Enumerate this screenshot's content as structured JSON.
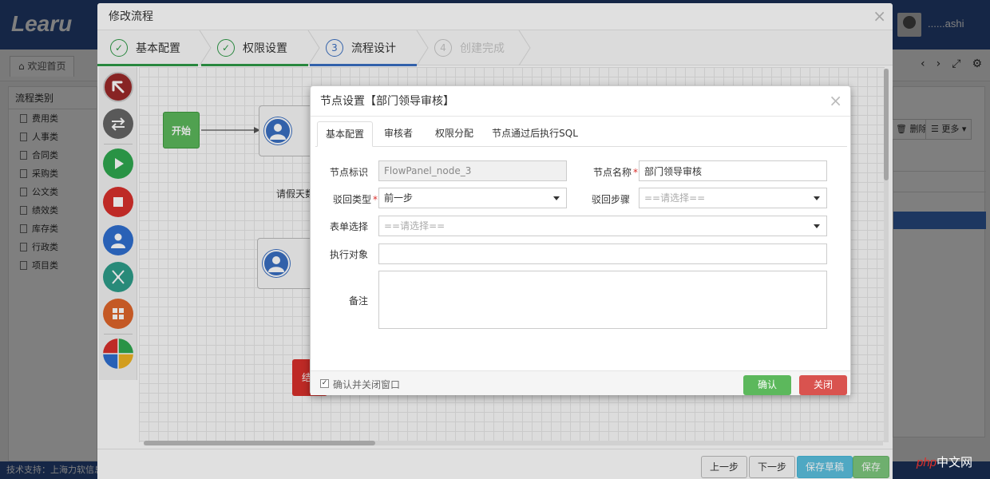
{
  "app": {
    "logo": "Learu",
    "user_name": "......ashi",
    "home_tab": "欢迎首页",
    "category_title": "流程类别",
    "categories": [
      "费用类",
      "人事类",
      "合同类",
      "采购类",
      "公文类",
      "绩效类",
      "库存类",
      "行政类",
      "项目类"
    ],
    "right_buttons": {
      "delete": "删除",
      "more": "更多"
    },
    "footer_text": "技术支持：上海力软信息",
    "watermark": "中文网",
    "watermark_php": "php"
  },
  "modal": {
    "title": "修改流程",
    "steps": [
      {
        "label": "基本配置",
        "marker": "✓",
        "state": "done"
      },
      {
        "label": "权限设置",
        "marker": "✓",
        "state": "done"
      },
      {
        "label": "流程设计",
        "marker": "3",
        "state": "active"
      },
      {
        "label": "创建完成",
        "marker": "4",
        "state": "disabled"
      }
    ],
    "tools": [
      {
        "name": "cursor-tool",
        "color": "#9b2a2a",
        "icon": "arrow-up-left-icon"
      },
      {
        "name": "line-tool",
        "color": "#666666",
        "icon": "swap-arrows-icon"
      },
      {
        "name": "start-node-tool",
        "color": "#2fa84f",
        "icon": "play-icon"
      },
      {
        "name": "end-node-tool",
        "color": "#d9302c",
        "icon": "stop-icon"
      },
      {
        "name": "user-node-tool",
        "color": "#2f6fd0",
        "icon": "user-icon"
      },
      {
        "name": "branch-node-tool",
        "color": "#2e9e8a",
        "icon": "fork-icon"
      },
      {
        "name": "group-node-tool",
        "color": "#e0662b",
        "icon": "grid-icon"
      },
      {
        "name": "auto-node-tool",
        "color": "#multi",
        "icon": "pie-icon"
      }
    ],
    "canvas": {
      "start_node": "开始",
      "node_1_label": "请假天数",
      "end_node": "结"
    },
    "footer_buttons": {
      "prev": "上一步",
      "next": "下一步",
      "save_draft": "保存草稿",
      "save": "保存"
    }
  },
  "node_dialog": {
    "title": "节点设置【部门领导审核】",
    "tabs": [
      "基本配置",
      "审核者",
      "权限分配",
      "节点通过后执行SQL"
    ],
    "fields": {
      "node_id_label": "节点标识",
      "node_id_value": "FlowPanel_node_3",
      "node_name_label": "节点名称",
      "node_name_value": "部门领导审核",
      "reject_type_label": "驳回类型",
      "reject_type_value": "前一步",
      "reject_step_label": "驳回步骤",
      "reject_step_value": "==请选择==",
      "form_select_label": "表单选择",
      "form_select_value": "==请选择==",
      "executor_label": "执行对象",
      "executor_value": "",
      "remark_label": "备注"
    },
    "footer": {
      "checkbox_label": "确认并关闭窗口",
      "checked": true,
      "confirm": "确认",
      "close": "关闭"
    }
  }
}
